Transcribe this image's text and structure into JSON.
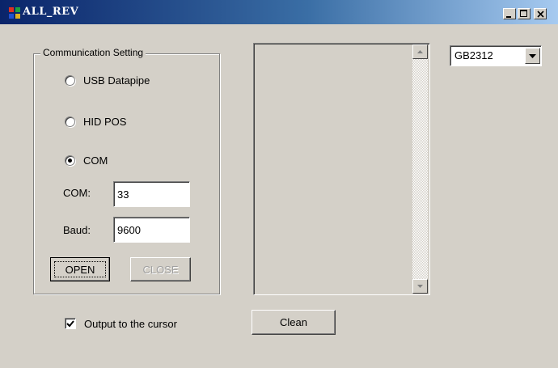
{
  "window": {
    "title": "ALL_REV",
    "controls": {
      "minimize": "minimize-icon",
      "maximize": "maximize-icon",
      "close": "close-icon"
    }
  },
  "communication": {
    "group_title": "Communication Setting",
    "radios": [
      {
        "label": "USB Datapipe",
        "checked": false
      },
      {
        "label": "HID POS",
        "checked": false
      },
      {
        "label": "COM",
        "checked": true
      }
    ],
    "com_label": "COM:",
    "com_value": "33",
    "baud_label": "Baud:",
    "baud_value": "9600",
    "open_label": "OPEN",
    "close_label": "CLOSE"
  },
  "encoding": {
    "selected": "GB2312"
  },
  "output": {
    "checkbox_label": "Output to the cursor",
    "checked": true
  },
  "clean_label": "Clean",
  "colors": {
    "face": "#d4d0c8",
    "title_start": "#0a246a",
    "title_end": "#a6caf0",
    "disabled_text": "#a0a0a0"
  }
}
